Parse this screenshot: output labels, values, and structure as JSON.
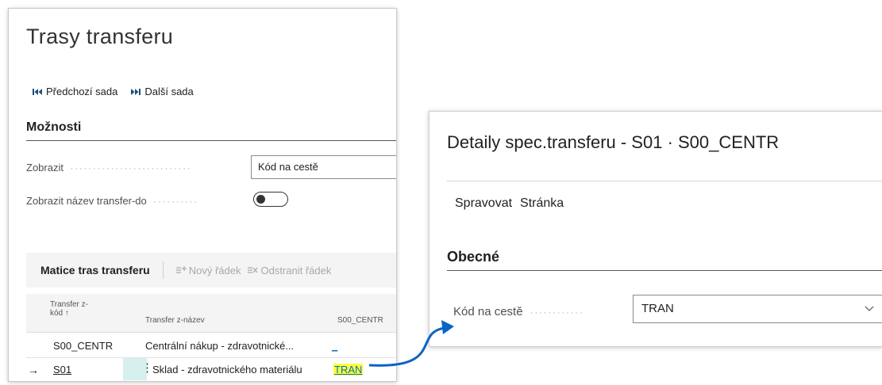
{
  "left": {
    "title": "Trasy transferu",
    "nav": {
      "prev": "Předchozí sada",
      "next": "Další sada"
    },
    "options_title": "Možnosti",
    "show_label": "Zobrazit",
    "show_value": "Kód na cestě",
    "show_name_label": "Zobrazit název transfer-do",
    "matrix": {
      "title": "Matice tras transferu",
      "new_row": "Nový řádek",
      "delete_row": "Odstranit řádek",
      "headers": {
        "from_code_1": "Transfer z-",
        "from_code_2": "kód ↑",
        "from_name": "Transfer z-název",
        "col": "S00_CENTR"
      },
      "rows": [
        {
          "code": "S00_CENTR",
          "name": "Centrální nákup - zdravotnické...",
          "value": "_"
        },
        {
          "code": "S01",
          "name": "Sklad - zdravotnického materiálu",
          "value": "TRAN"
        }
      ]
    }
  },
  "right": {
    "title": "Detaily spec.transferu - S01 · S00_CENTR",
    "actions": [
      "Spravovat",
      "Stránka"
    ],
    "section": "Obecné",
    "field_label": "Kód na cestě",
    "field_value": "TRAN"
  },
  "colors": {
    "accent": "#0070c0",
    "highlight": "#ffff3c",
    "row_marker": "#d6efef"
  }
}
